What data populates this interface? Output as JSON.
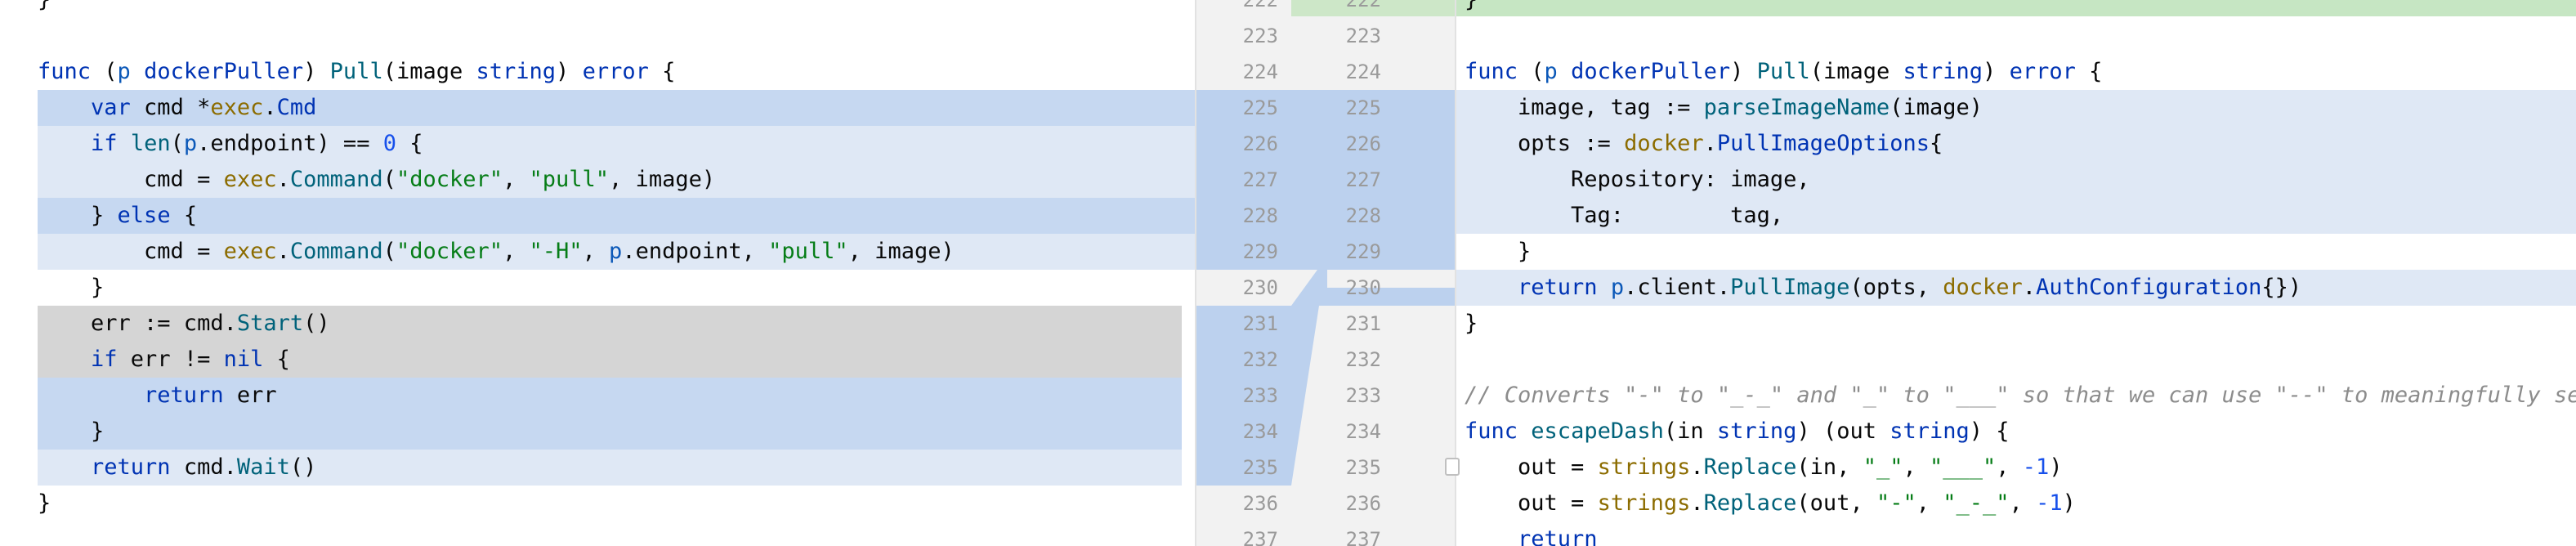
{
  "left": {
    "lines": [
      {
        "tokens": [
          {
            "t": "}",
            "c": ""
          }
        ]
      },
      {
        "tokens": []
      },
      {
        "tokens": [
          {
            "t": "func",
            "c": "kw"
          },
          {
            "t": " (",
            "c": ""
          },
          {
            "t": "p",
            "c": "rcv"
          },
          {
            "t": " ",
            "c": ""
          },
          {
            "t": "dockerPuller",
            "c": "ty"
          },
          {
            "t": ") ",
            "c": ""
          },
          {
            "t": "Pull",
            "c": "fn"
          },
          {
            "t": "(image ",
            "c": ""
          },
          {
            "t": "string",
            "c": "ty"
          },
          {
            "t": ") ",
            "c": ""
          },
          {
            "t": "error",
            "c": "ty"
          },
          {
            "t": " {",
            "c": ""
          }
        ]
      },
      {
        "tokens": [
          {
            "t": "    var",
            "c": "kw"
          },
          {
            "t": " cmd *",
            "c": ""
          },
          {
            "t": "exec",
            "c": "pkg"
          },
          {
            "t": ".",
            "c": ""
          },
          {
            "t": "Cmd",
            "c": "ty"
          }
        ]
      },
      {
        "tokens": [
          {
            "t": "    if",
            "c": "kw"
          },
          {
            "t": " ",
            "c": ""
          },
          {
            "t": "len",
            "c": "fn"
          },
          {
            "t": "(",
            "c": ""
          },
          {
            "t": "p",
            "c": "rcv"
          },
          {
            "t": ".endpoint) == ",
            "c": ""
          },
          {
            "t": "0",
            "c": "num"
          },
          {
            "t": " {",
            "c": ""
          }
        ]
      },
      {
        "tokens": [
          {
            "t": "        cmd = ",
            "c": ""
          },
          {
            "t": "exec",
            "c": "pkg"
          },
          {
            "t": ".",
            "c": ""
          },
          {
            "t": "Command",
            "c": "fn"
          },
          {
            "t": "(",
            "c": ""
          },
          {
            "t": "\"docker\"",
            "c": "str"
          },
          {
            "t": ", ",
            "c": ""
          },
          {
            "t": "\"pull\"",
            "c": "str"
          },
          {
            "t": ", image)",
            "c": ""
          }
        ]
      },
      {
        "tokens": [
          {
            "t": "    } ",
            "c": ""
          },
          {
            "t": "else",
            "c": "kw"
          },
          {
            "t": " {",
            "c": ""
          }
        ]
      },
      {
        "tokens": [
          {
            "t": "        cmd = ",
            "c": ""
          },
          {
            "t": "exec",
            "c": "pkg"
          },
          {
            "t": ".",
            "c": ""
          },
          {
            "t": "Command",
            "c": "fn"
          },
          {
            "t": "(",
            "c": ""
          },
          {
            "t": "\"docker\"",
            "c": "str"
          },
          {
            "t": ", ",
            "c": ""
          },
          {
            "t": "\"-H\"",
            "c": "str"
          },
          {
            "t": ", ",
            "c": ""
          },
          {
            "t": "p",
            "c": "rcv"
          },
          {
            "t": ".endpoint, ",
            "c": ""
          },
          {
            "t": "\"pull\"",
            "c": "str"
          },
          {
            "t": ", image)",
            "c": ""
          }
        ]
      },
      {
        "tokens": [
          {
            "t": "    }",
            "c": ""
          }
        ]
      },
      {
        "tokens": [
          {
            "t": "    err := cmd.",
            "c": ""
          },
          {
            "t": "Start",
            "c": "fn"
          },
          {
            "t": "()",
            "c": ""
          }
        ]
      },
      {
        "tokens": [
          {
            "t": "    if",
            "c": "kw"
          },
          {
            "t": " err != ",
            "c": ""
          },
          {
            "t": "nil",
            "c": "kw"
          },
          {
            "t": " {",
            "c": ""
          }
        ]
      },
      {
        "tokens": [
          {
            "t": "        return",
            "c": "kw"
          },
          {
            "t": " err",
            "c": ""
          }
        ]
      },
      {
        "tokens": [
          {
            "t": "    }",
            "c": ""
          }
        ]
      },
      {
        "tokens": [
          {
            "t": "    return",
            "c": "kw"
          },
          {
            "t": " cmd.",
            "c": ""
          },
          {
            "t": "Wait",
            "c": "fn"
          },
          {
            "t": "()",
            "c": ""
          }
        ]
      },
      {
        "tokens": [
          {
            "t": "}",
            "c": ""
          }
        ]
      }
    ]
  },
  "gutter": {
    "left_numbers": [
      "222",
      "223",
      "224",
      "225",
      "226",
      "227",
      "228",
      "229",
      "230",
      "231",
      "232",
      "233",
      "234",
      "235",
      "236",
      "237"
    ],
    "right_numbers": [
      "222",
      "223",
      "224",
      "225",
      "226",
      "227",
      "228",
      "229",
      "230",
      "231",
      "232",
      "233",
      "234",
      "235",
      "236",
      "237"
    ]
  },
  "right": {
    "lines": [
      {
        "tokens": [
          {
            "t": "}",
            "c": ""
          }
        ]
      },
      {
        "tokens": []
      },
      {
        "tokens": [
          {
            "t": "func",
            "c": "kw"
          },
          {
            "t": " (",
            "c": ""
          },
          {
            "t": "p",
            "c": "rcv"
          },
          {
            "t": " ",
            "c": ""
          },
          {
            "t": "dockerPuller",
            "c": "ty"
          },
          {
            "t": ") ",
            "c": ""
          },
          {
            "t": "Pull",
            "c": "fn"
          },
          {
            "t": "(image ",
            "c": ""
          },
          {
            "t": "string",
            "c": "ty"
          },
          {
            "t": ") ",
            "c": ""
          },
          {
            "t": "error",
            "c": "ty"
          },
          {
            "t": " {",
            "c": ""
          }
        ]
      },
      {
        "tokens": [
          {
            "t": "    image, tag := ",
            "c": ""
          },
          {
            "t": "parseImageName",
            "c": "fn"
          },
          {
            "t": "(image)",
            "c": ""
          }
        ]
      },
      {
        "tokens": [
          {
            "t": "    opts := ",
            "c": ""
          },
          {
            "t": "docker",
            "c": "pkg"
          },
          {
            "t": ".",
            "c": ""
          },
          {
            "t": "PullImageOptions",
            "c": "ty"
          },
          {
            "t": "{",
            "c": ""
          }
        ]
      },
      {
        "tokens": [
          {
            "t": "        Repository: image,",
            "c": ""
          }
        ]
      },
      {
        "tokens": [
          {
            "t": "        Tag:        tag,",
            "c": ""
          }
        ]
      },
      {
        "tokens": [
          {
            "t": "    }",
            "c": ""
          }
        ]
      },
      {
        "tokens": [
          {
            "t": "    return",
            "c": "kw"
          },
          {
            "t": " ",
            "c": ""
          },
          {
            "t": "p",
            "c": "rcv"
          },
          {
            "t": ".client.",
            "c": ""
          },
          {
            "t": "PullImage",
            "c": "fn"
          },
          {
            "t": "(opts, ",
            "c": ""
          },
          {
            "t": "docker",
            "c": "pkg"
          },
          {
            "t": ".",
            "c": ""
          },
          {
            "t": "AuthConfiguration",
            "c": "ty"
          },
          {
            "t": "{})",
            "c": ""
          }
        ]
      },
      {
        "tokens": [
          {
            "t": "}",
            "c": ""
          }
        ]
      },
      {
        "tokens": []
      },
      {
        "tokens": [
          {
            "t": "// Converts \"-\" to \"_-_\" and \"_\" to \"___\" so that we can use \"--\" to meaningfully sep",
            "c": "cmt"
          }
        ]
      },
      {
        "tokens": [
          {
            "t": "func",
            "c": "kw"
          },
          {
            "t": " ",
            "c": ""
          },
          {
            "t": "escapeDash",
            "c": "fn"
          },
          {
            "t": "(in ",
            "c": ""
          },
          {
            "t": "string",
            "c": "ty"
          },
          {
            "t": ") (out ",
            "c": ""
          },
          {
            "t": "string",
            "c": "ty"
          },
          {
            "t": ") {",
            "c": ""
          }
        ]
      },
      {
        "tokens": [
          {
            "t": "    out = ",
            "c": ""
          },
          {
            "t": "strings",
            "c": "pkg"
          },
          {
            "t": ".",
            "c": ""
          },
          {
            "t": "Replace",
            "c": "fn"
          },
          {
            "t": "(in, ",
            "c": ""
          },
          {
            "t": "\"_\"",
            "c": "str"
          },
          {
            "t": ", ",
            "c": ""
          },
          {
            "t": "\"___\"",
            "c": "str"
          },
          {
            "t": ", ",
            "c": ""
          },
          {
            "t": "-1",
            "c": "num"
          },
          {
            "t": ")",
            "c": ""
          }
        ]
      },
      {
        "tokens": [
          {
            "t": "    out = ",
            "c": ""
          },
          {
            "t": "strings",
            "c": "pkg"
          },
          {
            "t": ".",
            "c": ""
          },
          {
            "t": "Replace",
            "c": "fn"
          },
          {
            "t": "(out, ",
            "c": ""
          },
          {
            "t": "\"-\"",
            "c": "str"
          },
          {
            "t": ", ",
            "c": ""
          },
          {
            "t": "\"_-_\"",
            "c": "str"
          },
          {
            "t": ", ",
            "c": ""
          },
          {
            "t": "-1",
            "c": "num"
          },
          {
            "t": ")",
            "c": ""
          }
        ]
      },
      {
        "tokens": [
          {
            "t": "    return",
            "c": "kw"
          }
        ]
      }
    ]
  }
}
